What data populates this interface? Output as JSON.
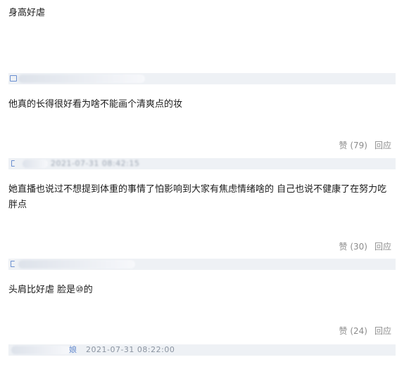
{
  "post": {
    "title": "身高好虐"
  },
  "comments": [
    {
      "text": "他真的长得很好看为啥不能画个清爽点的妆",
      "like_label": "赞 (79)",
      "reply_label": "回应"
    },
    {
      "meta_timestamp": "2021-07-31 08:42:15",
      "text": "她直播也说过不想提到体重的事情了怕影响到大家有焦虑情绪啥的 自己也说不健康了在努力吃胖点",
      "like_label": "赞 (30)",
      "reply_label": "回应"
    },
    {
      "text": "头肩比好虐 脸是⑩的",
      "like_label": "赞 (24)",
      "reply_label": "回应"
    },
    {
      "meta_tag": "娘",
      "meta_timestamp": "2021-07-31 08:22:00"
    }
  ],
  "colors": {
    "accent": "#6a8fd0",
    "meta_bg": "#eef1f5",
    "muted": "#8c8c8c"
  }
}
